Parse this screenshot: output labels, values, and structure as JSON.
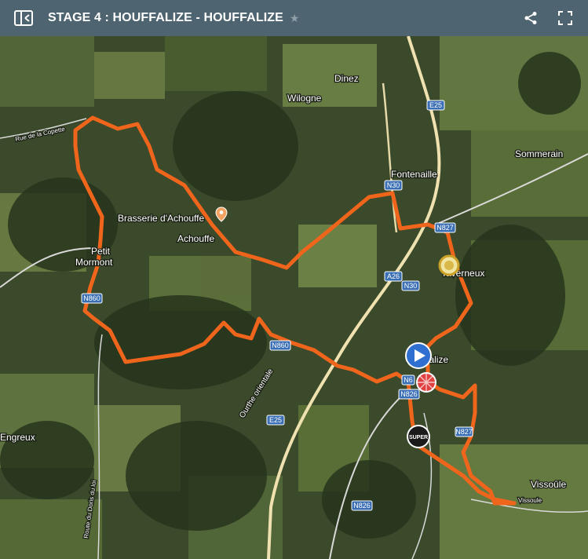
{
  "header": {
    "title": "STAGE 4 : HOUFFALIZE - HOUFFALIZE",
    "icons": [
      "sidebar-toggle-icon",
      "star-icon",
      "share-icon",
      "fullscreen-icon"
    ]
  },
  "colors": {
    "header_bg": "#4e6470",
    "route": "#f0651c",
    "road_badge": "#3b6fb5",
    "start_marker": "#2f6fcf",
    "finish_marker": "#e04040"
  },
  "map": {
    "places": {
      "dinez": "Dinez",
      "wilogne": "Wilogne",
      "fontenaille": "Fontenaille",
      "sommerain": "Sommerain",
      "brasserie": "Brasserie d'Achouffe",
      "achouffe": "Achouffe",
      "petit": "Petit",
      "mormont": "Mormont",
      "taverneux": "Taverneux",
      "houffalize": "Houffalize",
      "engreux": "Engreux",
      "vissoule": "Vissoûle",
      "vissoule_road": "Vissoule",
      "rue_copette": "Rue de la Copette",
      "ourthe": "Ourthe orientale",
      "route_doris": "Route du Doris du loi"
    },
    "roads": {
      "e25_top": "E25",
      "e25_bottom": "E25",
      "n30_top": "N30",
      "n30_mid": "N30",
      "n827_top": "N827",
      "n827_low": "N827",
      "a26": "A26",
      "n860_left": "N860",
      "n860_mid": "N860",
      "n826": "N826",
      "n826_bottom": "N826",
      "n_partial": "N6"
    },
    "markers": {
      "start": "start-marker",
      "finish": "finish-marker",
      "poi": "brasserie-pin",
      "super_badge": "SUPER",
      "gold_badge": "gold-medal"
    }
  }
}
